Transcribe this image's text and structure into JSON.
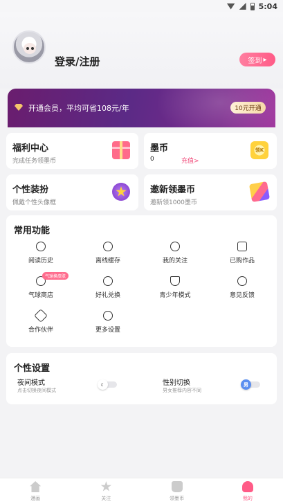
{
  "status_bar": {
    "time": "5:04"
  },
  "profile": {
    "login_label": "登录/注册",
    "signin_button": "签到"
  },
  "vip_banner": {
    "text": "开通会员，平均可省108元/年",
    "button": "10元开通"
  },
  "cards": [
    {
      "title": "福利中心",
      "subtitle": "完成任务领墨币",
      "icon": "gift-icon"
    },
    {
      "title": "墨币",
      "subtitle": "0",
      "link": "充值>",
      "icon": "coin-icon",
      "coin_text": "领K"
    },
    {
      "title": "个性装扮",
      "subtitle": "佩戴个性头像框",
      "icon": "star-icon"
    },
    {
      "title": "邀新领墨币",
      "subtitle": "邀新领1000墨币",
      "icon": "bag-icon"
    }
  ],
  "common": {
    "title": "常用功能",
    "items": [
      {
        "label": "阅读历史",
        "icon": "history-icon"
      },
      {
        "label": "离线缓存",
        "icon": "download-icon"
      },
      {
        "label": "我的关注",
        "icon": "heart-icon"
      },
      {
        "label": "已购作品",
        "icon": "purchased-icon"
      },
      {
        "label": "气球商店",
        "icon": "balloon-icon",
        "badge": "气球换皮肤"
      },
      {
        "label": "好礼兑换",
        "icon": "exchange-icon"
      },
      {
        "label": "青少年模式",
        "icon": "shield-icon"
      },
      {
        "label": "意见反馈",
        "icon": "feedback-icon"
      },
      {
        "label": "合作伙伴",
        "icon": "handshake-icon"
      },
      {
        "label": "更多设置",
        "icon": "settings-icon"
      }
    ]
  },
  "personal": {
    "title": "个性设置",
    "night": {
      "label": "夜间模式",
      "sub": "点击切换夜间模式",
      "icon": "moon-icon"
    },
    "gender": {
      "label": "性别切换",
      "sub": "男女推荐内容不同",
      "knob": "男"
    }
  },
  "tabs": [
    {
      "label": "漫画",
      "icon": "home-icon",
      "active": false
    },
    {
      "label": "关注",
      "icon": "star-icon",
      "active": false
    },
    {
      "label": "领墨币",
      "icon": "bag-icon",
      "active": false
    },
    {
      "label": "我的",
      "icon": "profile-icon",
      "active": true
    }
  ]
}
